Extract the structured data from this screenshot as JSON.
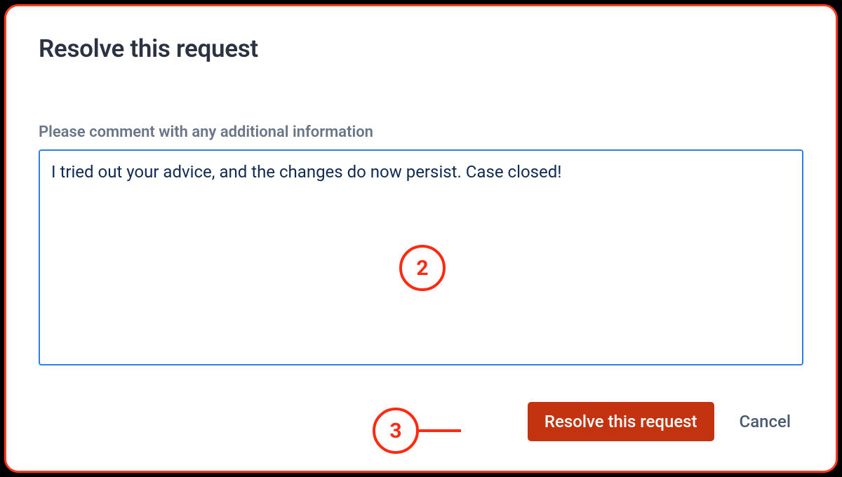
{
  "dialog": {
    "title": "Resolve this request",
    "comment_label": "Please comment with any additional information",
    "comment_value": "I tried out your advice, and the changes do now persist. Case closed!",
    "resolve_button": "Resolve this request",
    "cancel_button": "Cancel"
  },
  "annotations": {
    "step2": "2",
    "step3": "3"
  }
}
